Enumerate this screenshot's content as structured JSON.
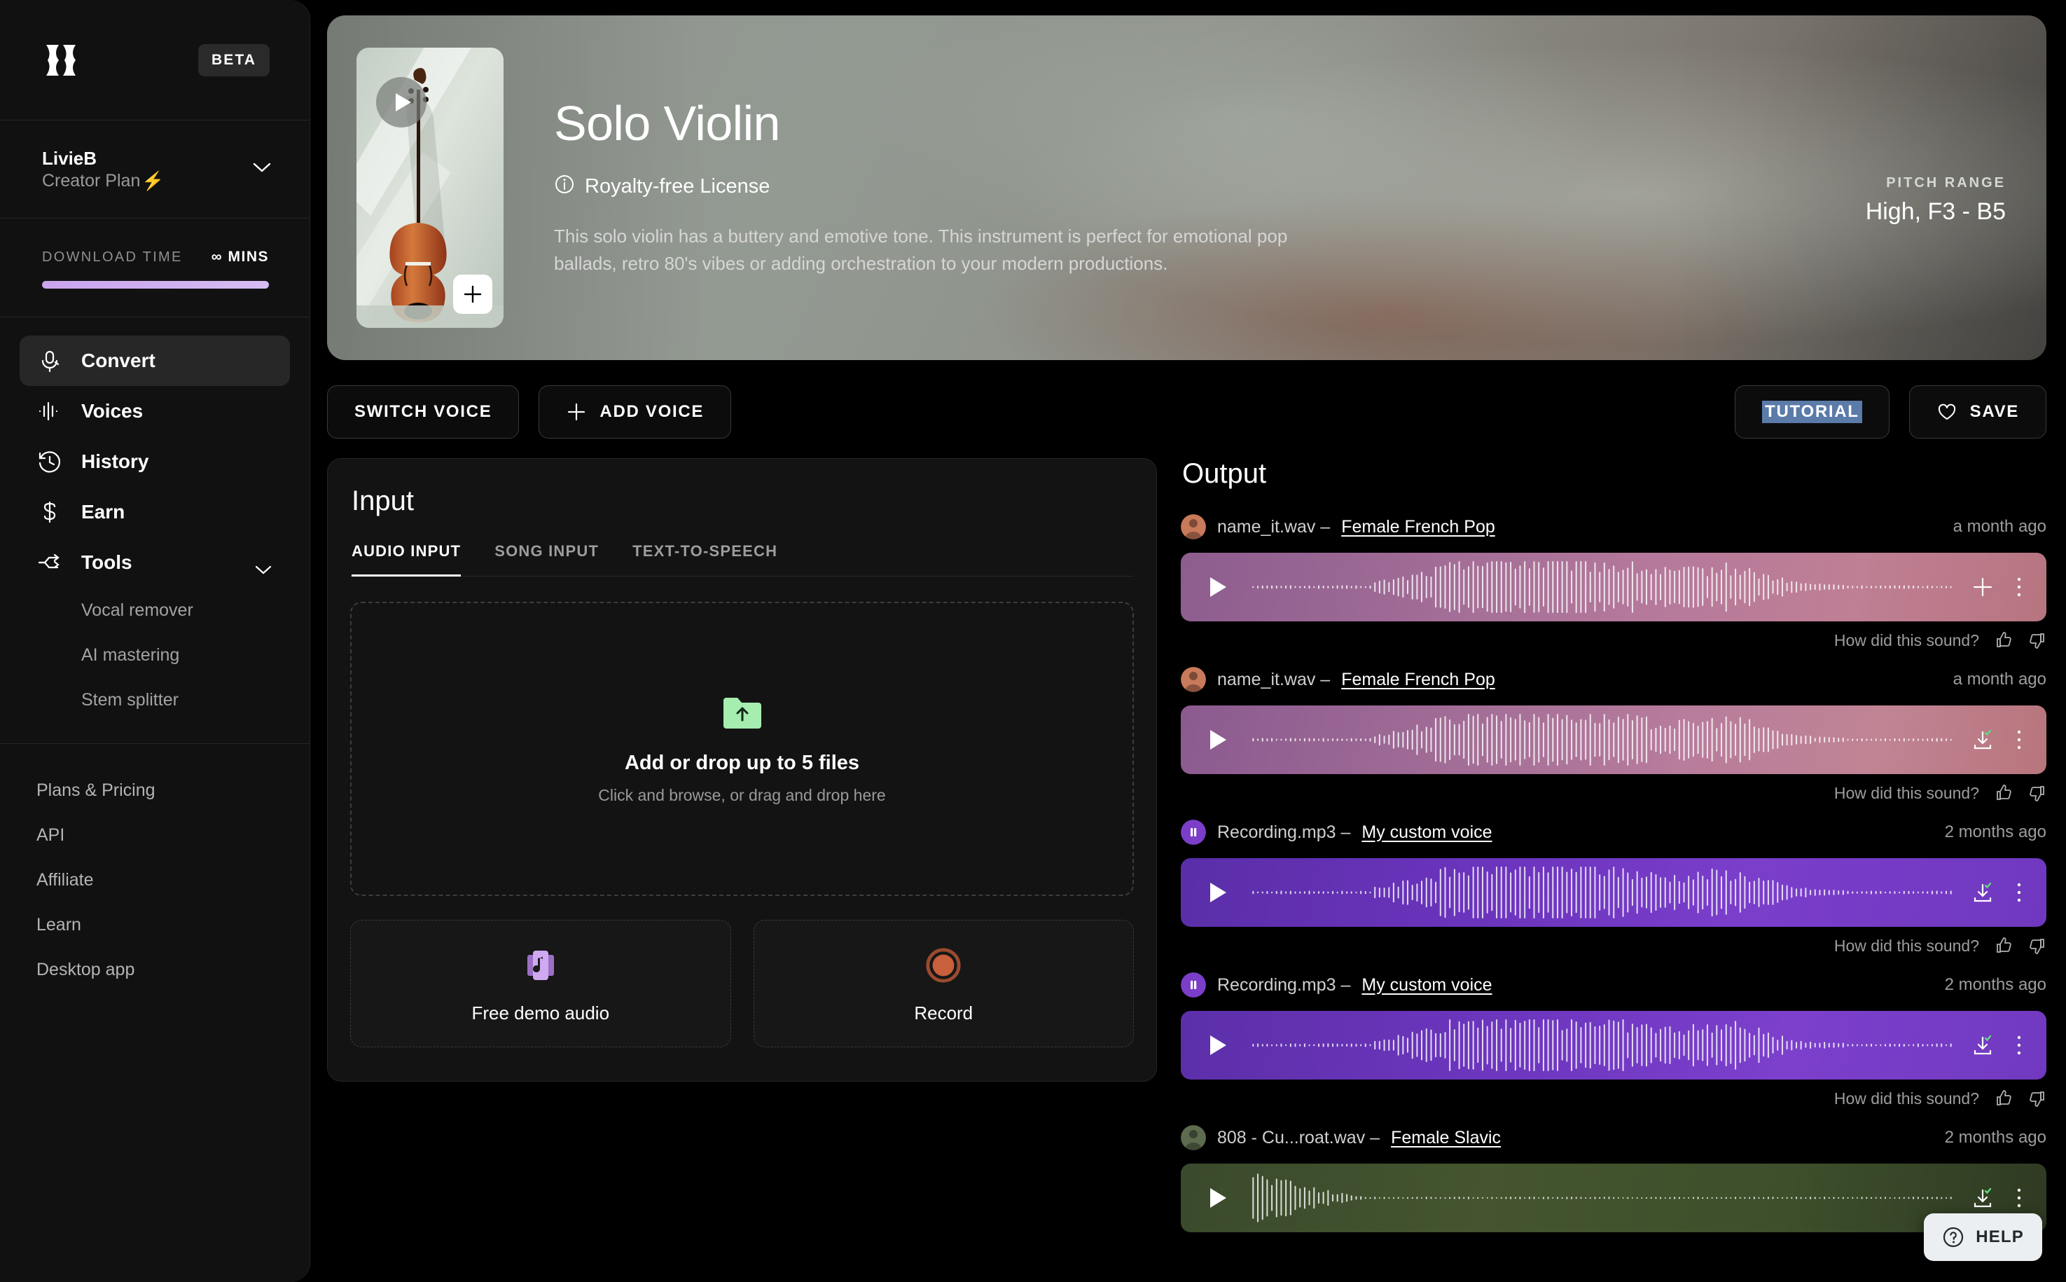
{
  "sidebar": {
    "logo_icon": "kits-logo-icon",
    "beta_label": "BETA",
    "user": {
      "name": "LivieB",
      "plan": "Creator Plan",
      "bolt_icon": "bolt-icon",
      "chevron_icon": "chevron-down-icon"
    },
    "download": {
      "label": "DOWNLOAD TIME",
      "value": "∞ MINS",
      "progress_pct": 100,
      "bar_color": "#cfb0f0"
    },
    "nav": [
      {
        "label": "Convert",
        "icon": "microphone-icon",
        "active": true
      },
      {
        "label": "Voices",
        "icon": "waveform-icon",
        "active": false
      },
      {
        "label": "History",
        "icon": "clock-history-icon",
        "active": false
      },
      {
        "label": "Earn",
        "icon": "dollar-icon",
        "active": false
      },
      {
        "label": "Tools",
        "icon": "tools-shuffle-icon",
        "active": false,
        "expandable": true
      }
    ],
    "tools_sub": [
      "Vocal remover",
      "AI mastering",
      "Stem splitter"
    ],
    "links": [
      "Plans & Pricing",
      "API",
      "Affiliate",
      "Learn",
      "Desktop app"
    ]
  },
  "hero": {
    "title": "Solo Violin",
    "license": "Royalty-free License",
    "license_icon": "info-icon",
    "description": "This solo violin has a buttery and emotive tone. This instrument is perfect for emotional pop ballads, retro 80's vibes or adding orchestration to your modern productions.",
    "pitch_label": "PITCH RANGE",
    "pitch_value": "High, F3 - B5",
    "play_icon": "play-icon",
    "add_icon": "plus-icon"
  },
  "actions": {
    "switch_voice": "SWITCH VOICE",
    "add_voice": "ADD VOICE",
    "add_voice_icon": "plus-icon",
    "tutorial": "TUTORIAL",
    "tutorial_selected": true,
    "save": "SAVE",
    "save_icon": "heart-icon"
  },
  "input": {
    "title": "Input",
    "tabs": [
      {
        "label": "AUDIO INPUT",
        "active": true
      },
      {
        "label": "SONG INPUT",
        "active": false
      },
      {
        "label": "TEXT-TO-SPEECH",
        "active": false
      }
    ],
    "dropzone": {
      "icon": "upload-folder-icon",
      "icon_color": "#a6edb0",
      "title": "Add or drop up to 5 files",
      "subtitle": "Click and browse, or drag and drop here"
    },
    "cards": [
      {
        "label": "Free demo audio",
        "icon": "music-note-icon",
        "icon_color": "#c9a4ef"
      },
      {
        "label": "Record",
        "icon": "record-circle-icon",
        "icon_color": "#c8603b"
      }
    ]
  },
  "output": {
    "title": "Output",
    "feedback_prompt": "How did this sound?",
    "thumbs_up_icon": "thumbs-up-icon",
    "thumbs_down_icon": "thumbs-down-icon",
    "rows": [
      {
        "file": "name_it.wav",
        "sep": "–",
        "voice": "Female French Pop",
        "time": "a month ago",
        "avatar_color": "#c97a5a",
        "avatar_icon": "voice-avatar-icon",
        "player_class": "pl-a",
        "action_icon": "plus-icon",
        "menu_icon": "more-vertical-icon",
        "show_feedback": true
      },
      {
        "file": "name_it.wav",
        "sep": "–",
        "voice": "Female French Pop",
        "time": "a month ago",
        "avatar_color": "#c97a5a",
        "avatar_icon": "voice-avatar-icon",
        "player_class": "pl-b",
        "action_icon": "download-done-icon",
        "menu_icon": "more-vertical-icon",
        "show_feedback": true
      },
      {
        "file": "Recording.mp3",
        "sep": "–",
        "voice": "My custom voice",
        "time": "2 months ago",
        "avatar_color": "#7b3ec9",
        "avatar_icon": "pause-avatar-icon",
        "player_class": "pl-c",
        "action_icon": "download-done-icon",
        "menu_icon": "more-vertical-icon",
        "show_feedback": true
      },
      {
        "file": "Recording.mp3",
        "sep": "–",
        "voice": "My custom voice",
        "time": "2 months ago",
        "avatar_color": "#7b3ec9",
        "avatar_icon": "pause-avatar-icon",
        "player_class": "pl-d",
        "action_icon": "download-done-icon",
        "menu_icon": "more-vertical-icon",
        "show_feedback": true
      },
      {
        "file": "808 - Cu...roat.wav",
        "sep": "–",
        "voice": "Female Slavic",
        "time": "2 months ago",
        "avatar_color": "#5d6b4e",
        "avatar_icon": "voice-avatar-icon",
        "player_class": "pl-e",
        "action_icon": "download-done-icon",
        "menu_icon": "more-vertical-icon",
        "show_feedback": false
      }
    ]
  },
  "help": {
    "label": "HELP",
    "icon": "question-circle-icon"
  }
}
